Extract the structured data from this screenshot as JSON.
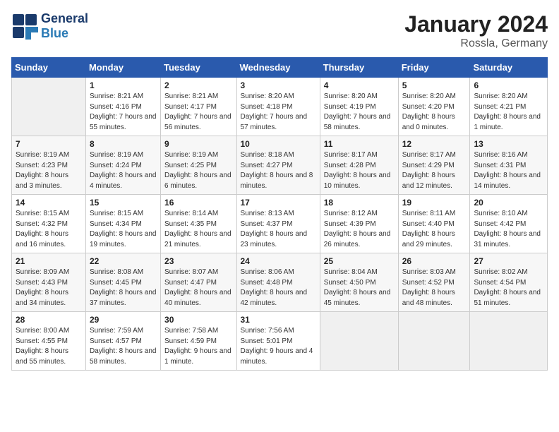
{
  "header": {
    "logo_text_general": "General",
    "logo_text_blue": "Blue",
    "title": "January 2024",
    "subtitle": "Rossla, Germany"
  },
  "calendar": {
    "days_of_week": [
      "Sunday",
      "Monday",
      "Tuesday",
      "Wednesday",
      "Thursday",
      "Friday",
      "Saturday"
    ],
    "weeks": [
      [
        {
          "day": "",
          "sunrise": "",
          "sunset": "",
          "daylight": ""
        },
        {
          "day": "1",
          "sunrise": "8:21 AM",
          "sunset": "4:16 PM",
          "daylight": "7 hours and 55 minutes."
        },
        {
          "day": "2",
          "sunrise": "8:21 AM",
          "sunset": "4:17 PM",
          "daylight": "7 hours and 56 minutes."
        },
        {
          "day": "3",
          "sunrise": "8:20 AM",
          "sunset": "4:18 PM",
          "daylight": "7 hours and 57 minutes."
        },
        {
          "day": "4",
          "sunrise": "8:20 AM",
          "sunset": "4:19 PM",
          "daylight": "7 hours and 58 minutes."
        },
        {
          "day": "5",
          "sunrise": "8:20 AM",
          "sunset": "4:20 PM",
          "daylight": "8 hours and 0 minutes."
        },
        {
          "day": "6",
          "sunrise": "8:20 AM",
          "sunset": "4:21 PM",
          "daylight": "8 hours and 1 minute."
        }
      ],
      [
        {
          "day": "7",
          "sunrise": "8:19 AM",
          "sunset": "4:23 PM",
          "daylight": "8 hours and 3 minutes."
        },
        {
          "day": "8",
          "sunrise": "8:19 AM",
          "sunset": "4:24 PM",
          "daylight": "8 hours and 4 minutes."
        },
        {
          "day": "9",
          "sunrise": "8:19 AM",
          "sunset": "4:25 PM",
          "daylight": "8 hours and 6 minutes."
        },
        {
          "day": "10",
          "sunrise": "8:18 AM",
          "sunset": "4:27 PM",
          "daylight": "8 hours and 8 minutes."
        },
        {
          "day": "11",
          "sunrise": "8:17 AM",
          "sunset": "4:28 PM",
          "daylight": "8 hours and 10 minutes."
        },
        {
          "day": "12",
          "sunrise": "8:17 AM",
          "sunset": "4:29 PM",
          "daylight": "8 hours and 12 minutes."
        },
        {
          "day": "13",
          "sunrise": "8:16 AM",
          "sunset": "4:31 PM",
          "daylight": "8 hours and 14 minutes."
        }
      ],
      [
        {
          "day": "14",
          "sunrise": "8:15 AM",
          "sunset": "4:32 PM",
          "daylight": "8 hours and 16 minutes."
        },
        {
          "day": "15",
          "sunrise": "8:15 AM",
          "sunset": "4:34 PM",
          "daylight": "8 hours and 19 minutes."
        },
        {
          "day": "16",
          "sunrise": "8:14 AM",
          "sunset": "4:35 PM",
          "daylight": "8 hours and 21 minutes."
        },
        {
          "day": "17",
          "sunrise": "8:13 AM",
          "sunset": "4:37 PM",
          "daylight": "8 hours and 23 minutes."
        },
        {
          "day": "18",
          "sunrise": "8:12 AM",
          "sunset": "4:39 PM",
          "daylight": "8 hours and 26 minutes."
        },
        {
          "day": "19",
          "sunrise": "8:11 AM",
          "sunset": "4:40 PM",
          "daylight": "8 hours and 29 minutes."
        },
        {
          "day": "20",
          "sunrise": "8:10 AM",
          "sunset": "4:42 PM",
          "daylight": "8 hours and 31 minutes."
        }
      ],
      [
        {
          "day": "21",
          "sunrise": "8:09 AM",
          "sunset": "4:43 PM",
          "daylight": "8 hours and 34 minutes."
        },
        {
          "day": "22",
          "sunrise": "8:08 AM",
          "sunset": "4:45 PM",
          "daylight": "8 hours and 37 minutes."
        },
        {
          "day": "23",
          "sunrise": "8:07 AM",
          "sunset": "4:47 PM",
          "daylight": "8 hours and 40 minutes."
        },
        {
          "day": "24",
          "sunrise": "8:06 AM",
          "sunset": "4:48 PM",
          "daylight": "8 hours and 42 minutes."
        },
        {
          "day": "25",
          "sunrise": "8:04 AM",
          "sunset": "4:50 PM",
          "daylight": "8 hours and 45 minutes."
        },
        {
          "day": "26",
          "sunrise": "8:03 AM",
          "sunset": "4:52 PM",
          "daylight": "8 hours and 48 minutes."
        },
        {
          "day": "27",
          "sunrise": "8:02 AM",
          "sunset": "4:54 PM",
          "daylight": "8 hours and 51 minutes."
        }
      ],
      [
        {
          "day": "28",
          "sunrise": "8:00 AM",
          "sunset": "4:55 PM",
          "daylight": "8 hours and 55 minutes."
        },
        {
          "day": "29",
          "sunrise": "7:59 AM",
          "sunset": "4:57 PM",
          "daylight": "8 hours and 58 minutes."
        },
        {
          "day": "30",
          "sunrise": "7:58 AM",
          "sunset": "4:59 PM",
          "daylight": "9 hours and 1 minute."
        },
        {
          "day": "31",
          "sunrise": "7:56 AM",
          "sunset": "5:01 PM",
          "daylight": "9 hours and 4 minutes."
        },
        {
          "day": "",
          "sunrise": "",
          "sunset": "",
          "daylight": ""
        },
        {
          "day": "",
          "sunrise": "",
          "sunset": "",
          "daylight": ""
        },
        {
          "day": "",
          "sunrise": "",
          "sunset": "",
          "daylight": ""
        }
      ]
    ]
  }
}
